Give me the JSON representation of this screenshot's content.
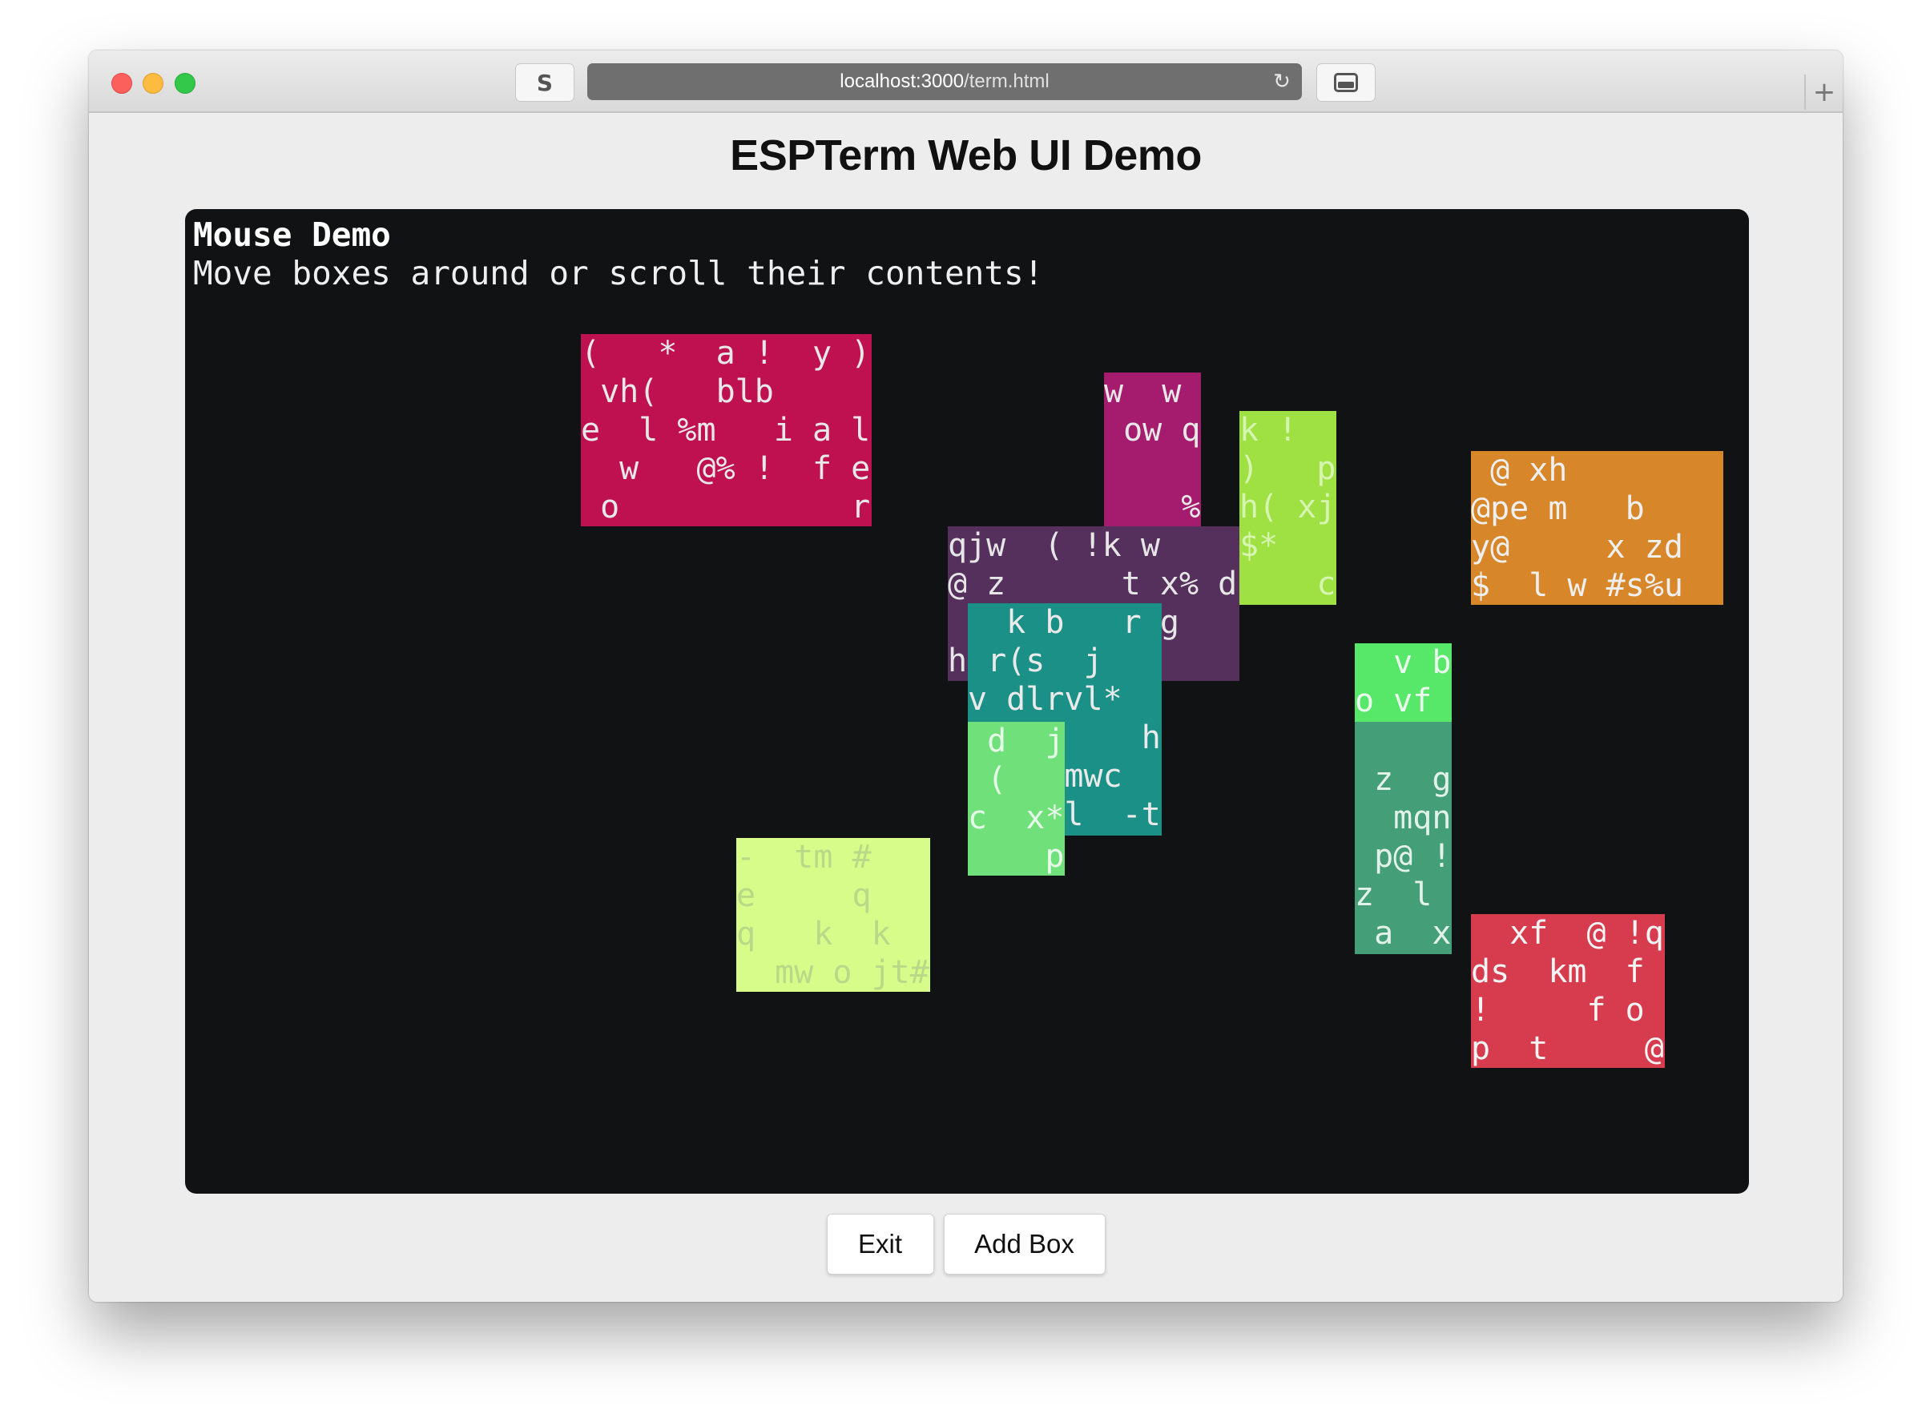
{
  "browser": {
    "tab_letter": "S",
    "url_host": "localhost:3000",
    "url_path": "/term.html",
    "new_tab_symbol": "+",
    "reload_symbol": "↻"
  },
  "page": {
    "title": "ESPTerm Web UI Demo"
  },
  "terminal": {
    "heading": "Mouse Demo",
    "subheading": "Move boxes around or scroll their contents!",
    "boxes": [
      {
        "bg": "#bf1050",
        "fg": "#e8e8e8",
        "lines": [
          "(   *  a !  y )",
          " vh(   blb",
          "e  l %m   i a l",
          "  w   @% !  f e",
          " o            rv"
        ]
      },
      {
        "bg": "#d7862a",
        "fg": "#efefef",
        "lines": [
          " @ xh",
          "@pe m   b",
          "y@     x zd",
          "$  l w #s%u"
        ]
      },
      {
        "bg": "#a51b6d",
        "fg": "#e8e8e8",
        "lines": [
          "w  w",
          " ow q",
          "",
          "    %l"
        ]
      },
      {
        "bg": "#9fe043",
        "fg": "#d6f5b0",
        "lines": [
          "k !",
          ")   p",
          "h( xj",
          "$*",
          "    c"
        ]
      },
      {
        "bg": "#55305c",
        "fg": "#e6e6e6",
        "lines": [
          "qjw  ( !k w",
          "@ z      t x% d",
          "           g",
          "h(        $"
        ]
      },
      {
        "bg": "#1b9087",
        "fg": "#eaeaea",
        "lines": [
          "  k b   r",
          " r(s  j",
          "v dlrvl*",
          "         h",
          "     mwc",
          "     l  -t"
        ]
      },
      {
        "bg": "#6fe07a",
        "fg": "#e6fae8",
        "lines": [
          " d  j",
          " (",
          "c  x*",
          "    p"
        ]
      },
      {
        "bg": "#d8fc8a",
        "fg": "#b9d888",
        "lines": [
          "-  tm #",
          "e     q    t",
          "q   k  k",
          "  mw o jt#"
        ]
      },
      {
        "bg": "#57e86a",
        "fg": "#eafaec",
        "lines": [
          "  v b",
          "o vf"
        ]
      },
      {
        "bg": "#449e77",
        "fg": "#e2f2ea",
        "lines": [
          "",
          " z  g",
          "  mqn",
          " p@ !",
          "z  l",
          " a  x"
        ]
      },
      {
        "bg": "#d63c4e",
        "fg": "#f4f4f4",
        "lines": [
          "  xf  @ !q",
          "ds  km  f",
          "!     f o",
          "p  t     @"
        ]
      }
    ]
  },
  "buttons": {
    "exit_label": "Exit",
    "add_box_label": "Add Box"
  }
}
